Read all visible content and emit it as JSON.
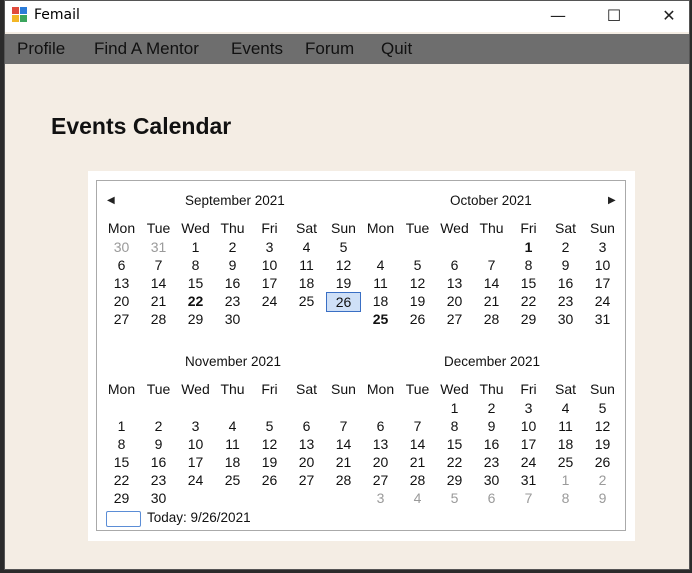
{
  "window": {
    "title": "Femail",
    "minimize": "—",
    "maximize": "☐",
    "close": "✕"
  },
  "menu": [
    "Profile",
    "Find A Mentor",
    "Events",
    "Forum",
    "Quit"
  ],
  "page": {
    "heading": "Events Calendar"
  },
  "calendar": {
    "prev_icon": "◀",
    "next_icon": "▶",
    "day_headers": [
      "Mon",
      "Tue",
      "Wed",
      "Thu",
      "Fri",
      "Sat",
      "Sun"
    ],
    "months": [
      {
        "title": "September 2021",
        "weeks": [
          [
            {
              "d": "30",
              "g": 1
            },
            {
              "d": "31",
              "g": 1
            },
            {
              "d": "1"
            },
            {
              "d": "2"
            },
            {
              "d": "3"
            },
            {
              "d": "4"
            },
            {
              "d": "5"
            }
          ],
          [
            {
              "d": "6"
            },
            {
              "d": "7"
            },
            {
              "d": "8"
            },
            {
              "d": "9"
            },
            {
              "d": "10"
            },
            {
              "d": "11"
            },
            {
              "d": "12"
            }
          ],
          [
            {
              "d": "13"
            },
            {
              "d": "14"
            },
            {
              "d": "15"
            },
            {
              "d": "16"
            },
            {
              "d": "17"
            },
            {
              "d": "18"
            },
            {
              "d": "19"
            }
          ],
          [
            {
              "d": "20"
            },
            {
              "d": "21"
            },
            {
              "d": "22",
              "b": 1
            },
            {
              "d": "23"
            },
            {
              "d": "24"
            },
            {
              "d": "25"
            },
            {
              "d": "26",
              "s": 1
            }
          ],
          [
            {
              "d": "27"
            },
            {
              "d": "28"
            },
            {
              "d": "29"
            },
            {
              "d": "30"
            },
            {
              "d": ""
            },
            {
              "d": ""
            },
            {
              "d": ""
            }
          ]
        ]
      },
      {
        "title": "October 2021",
        "weeks": [
          [
            {
              "d": ""
            },
            {
              "d": ""
            },
            {
              "d": ""
            },
            {
              "d": ""
            },
            {
              "d": "1",
              "b": 1
            },
            {
              "d": "2"
            },
            {
              "d": "3"
            }
          ],
          [
            {
              "d": "4"
            },
            {
              "d": "5"
            },
            {
              "d": "6"
            },
            {
              "d": "7"
            },
            {
              "d": "8"
            },
            {
              "d": "9"
            },
            {
              "d": "10"
            }
          ],
          [
            {
              "d": "11"
            },
            {
              "d": "12"
            },
            {
              "d": "13"
            },
            {
              "d": "14"
            },
            {
              "d": "15"
            },
            {
              "d": "16"
            },
            {
              "d": "17"
            }
          ],
          [
            {
              "d": "18"
            },
            {
              "d": "19"
            },
            {
              "d": "20"
            },
            {
              "d": "21"
            },
            {
              "d": "22"
            },
            {
              "d": "23"
            },
            {
              "d": "24"
            }
          ],
          [
            {
              "d": "25",
              "b": 1
            },
            {
              "d": "26"
            },
            {
              "d": "27"
            },
            {
              "d": "28"
            },
            {
              "d": "29"
            },
            {
              "d": "30"
            },
            {
              "d": "31"
            }
          ]
        ]
      },
      {
        "title": "November 2021",
        "weeks": [
          [
            {
              "d": ""
            },
            {
              "d": ""
            },
            {
              "d": ""
            },
            {
              "d": ""
            },
            {
              "d": ""
            },
            {
              "d": ""
            },
            {
              "d": ""
            }
          ],
          [
            {
              "d": "1"
            },
            {
              "d": "2"
            },
            {
              "d": "3"
            },
            {
              "d": "4"
            },
            {
              "d": "5"
            },
            {
              "d": "6"
            },
            {
              "d": "7"
            }
          ],
          [
            {
              "d": "8"
            },
            {
              "d": "9"
            },
            {
              "d": "10"
            },
            {
              "d": "11"
            },
            {
              "d": "12"
            },
            {
              "d": "13"
            },
            {
              "d": "14"
            }
          ],
          [
            {
              "d": "15"
            },
            {
              "d": "16"
            },
            {
              "d": "17"
            },
            {
              "d": "18"
            },
            {
              "d": "19"
            },
            {
              "d": "20"
            },
            {
              "d": "21"
            }
          ],
          [
            {
              "d": "22"
            },
            {
              "d": "23"
            },
            {
              "d": "24"
            },
            {
              "d": "25"
            },
            {
              "d": "26"
            },
            {
              "d": "27"
            },
            {
              "d": "28"
            }
          ],
          [
            {
              "d": "29"
            },
            {
              "d": "30"
            },
            {
              "d": ""
            },
            {
              "d": ""
            },
            {
              "d": ""
            },
            {
              "d": ""
            },
            {
              "d": ""
            }
          ]
        ]
      },
      {
        "title": "December 2021",
        "weeks": [
          [
            {
              "d": ""
            },
            {
              "d": ""
            },
            {
              "d": "1"
            },
            {
              "d": "2"
            },
            {
              "d": "3"
            },
            {
              "d": "4"
            },
            {
              "d": "5"
            }
          ],
          [
            {
              "d": "6"
            },
            {
              "d": "7"
            },
            {
              "d": "8"
            },
            {
              "d": "9"
            },
            {
              "d": "10"
            },
            {
              "d": "11"
            },
            {
              "d": "12"
            }
          ],
          [
            {
              "d": "13"
            },
            {
              "d": "14"
            },
            {
              "d": "15"
            },
            {
              "d": "16"
            },
            {
              "d": "17"
            },
            {
              "d": "18"
            },
            {
              "d": "19"
            }
          ],
          [
            {
              "d": "20"
            },
            {
              "d": "21"
            },
            {
              "d": "22"
            },
            {
              "d": "23"
            },
            {
              "d": "24"
            },
            {
              "d": "25"
            },
            {
              "d": "26"
            }
          ],
          [
            {
              "d": "27"
            },
            {
              "d": "28"
            },
            {
              "d": "29"
            },
            {
              "d": "30"
            },
            {
              "d": "31"
            },
            {
              "d": "1",
              "g": 1
            },
            {
              "d": "2",
              "g": 1
            }
          ],
          [
            {
              "d": "3",
              "g": 1
            },
            {
              "d": "4",
              "g": 1
            },
            {
              "d": "5",
              "g": 1
            },
            {
              "d": "6",
              "g": 1
            },
            {
              "d": "7",
              "g": 1
            },
            {
              "d": "8",
              "g": 1
            },
            {
              "d": "9",
              "g": 1
            }
          ]
        ]
      }
    ],
    "today_label": "Today: 9/26/2021"
  },
  "colors": {
    "accent": "#3a6fc4",
    "menubar": "#6e6e6e",
    "background": "#f4ede4"
  }
}
